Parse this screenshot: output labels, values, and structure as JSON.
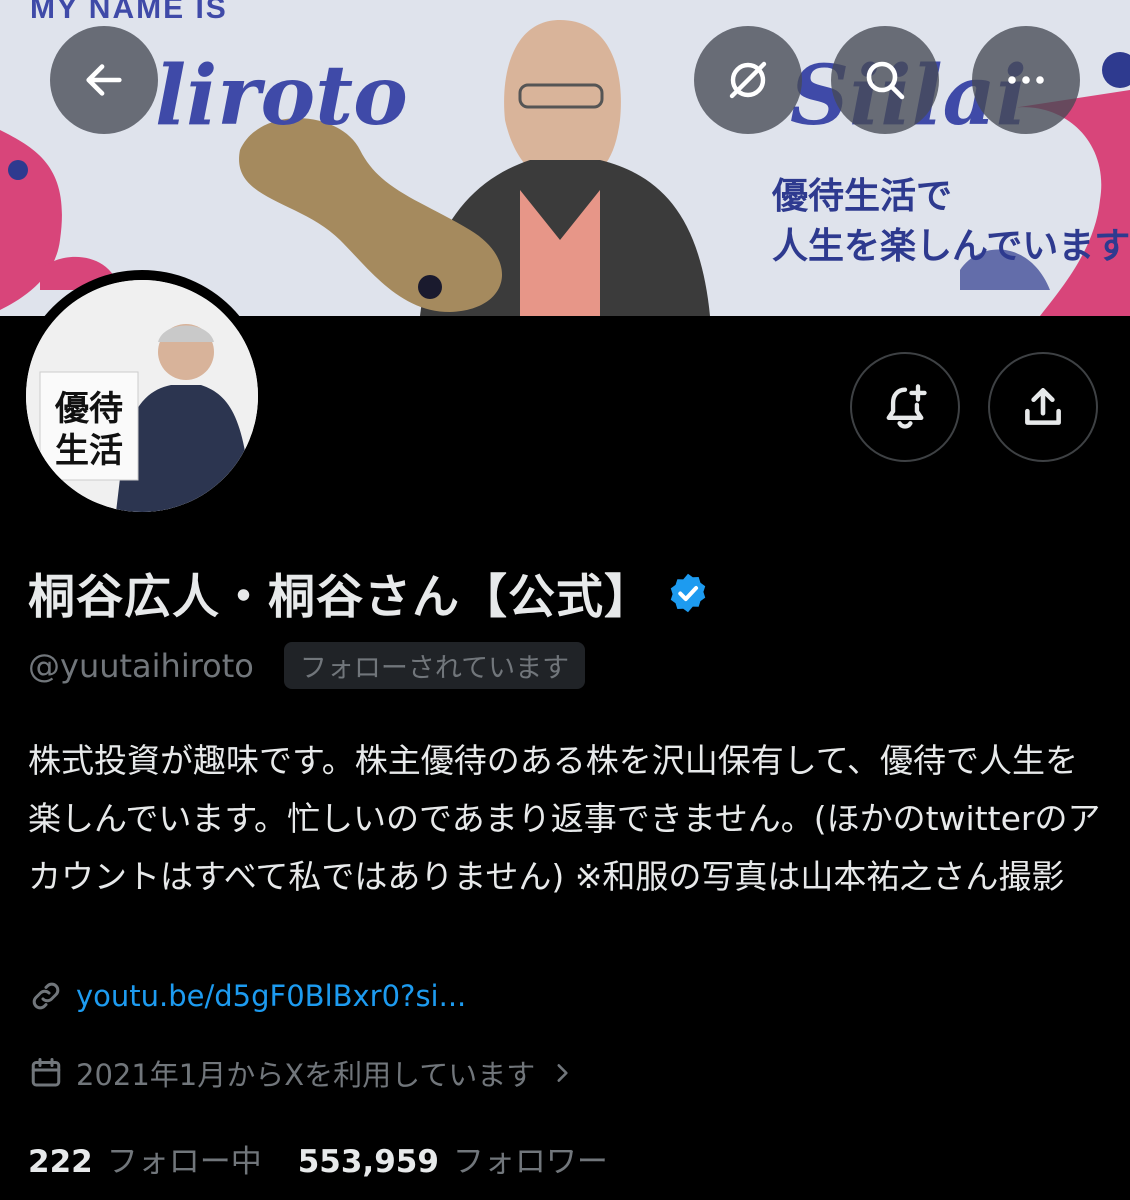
{
  "banner": {
    "tagline": "MY NAME IS",
    "name_left": "liroto",
    "name_right": "Siilai",
    "copy": "優待生活で\n人生を楽しんでいます",
    "avatar_sign": "優待生活"
  },
  "nav": {
    "back_icon": "arrow-left-icon",
    "grok_icon": "grok-icon",
    "search_icon": "search-icon",
    "more_icon": "more-icon"
  },
  "actions": {
    "notify_icon": "bell-plus-icon",
    "share_icon": "share-icon"
  },
  "profile": {
    "display_name": "桐谷広人・桐谷さん【公式】",
    "handle": "@yuutaihiroto",
    "follows_you": "フォローされています",
    "bio": "株式投資が趣味です。株主優待のある株を沢山保有して、優待で人生を楽しんでいます。忙しいのであまり返事できません。(ほかのtwitterのアカウントはすべて私ではありません) ※和服の写真は山本祐之さん撮影",
    "link": "youtu.be/d5gF0BlBxr0?si...",
    "joined": "2021年1月からXを利用しています"
  },
  "stats": {
    "following_count": "222",
    "following_label": "フォロー中",
    "followers_count": "553,959",
    "followers_label": "フォロワー"
  },
  "colors": {
    "background": "#000000",
    "text": "#e7e9ea",
    "muted": "#71767b",
    "link": "#1d9bf0",
    "verified": "#1d9bf0",
    "banner_accent": "#3f4aa8"
  }
}
